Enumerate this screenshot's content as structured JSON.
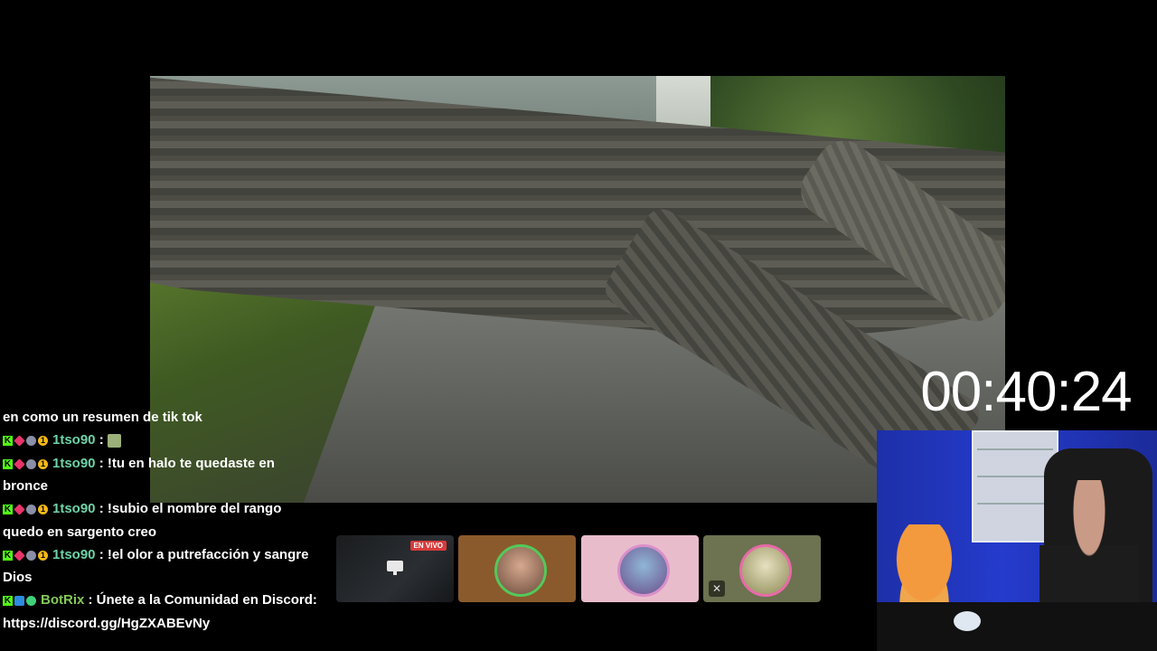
{
  "stream": {
    "timer": "00:40:24",
    "live_badge": "EN VIVO"
  },
  "chat": {
    "messages": [
      {
        "user": "",
        "badges": [],
        "text": "en como un resumen de tik tok"
      },
      {
        "user": "1tso90",
        "badges": [
          "kick-badge",
          "gem-badge",
          "wolf-badge",
          "coin-badge"
        ],
        "text": " : ",
        "emote": "emote-image"
      },
      {
        "user": "1tso90",
        "badges": [
          "kick-badge",
          "gem-badge",
          "wolf-badge",
          "coin-badge"
        ],
        "text": " : !tu en halo te quedaste en bronce"
      },
      {
        "user": "1tso90",
        "badges": [
          "kick-badge",
          "gem-badge",
          "wolf-badge",
          "coin-badge"
        ],
        "text": " : !subio el nombre del rango quedo en sargento creo"
      },
      {
        "user": "1tso90",
        "badges": [
          "kick-badge",
          "gem-badge",
          "wolf-badge",
          "coin-badge"
        ],
        "text": " : !el olor a putrefacción y sangre Dios"
      },
      {
        "user": "BotRix",
        "badges": [
          "kick-badge",
          "vip-badge",
          "verified-badge"
        ],
        "text": " : Únete a la Comunidad en Discord: https://discord.gg/HgZXABEvNy"
      }
    ]
  },
  "colors": {
    "username": "#6dd3a8",
    "bot_username": "#84c95a",
    "live_red": "#d83b3b",
    "kick_green": "#53fc18"
  }
}
